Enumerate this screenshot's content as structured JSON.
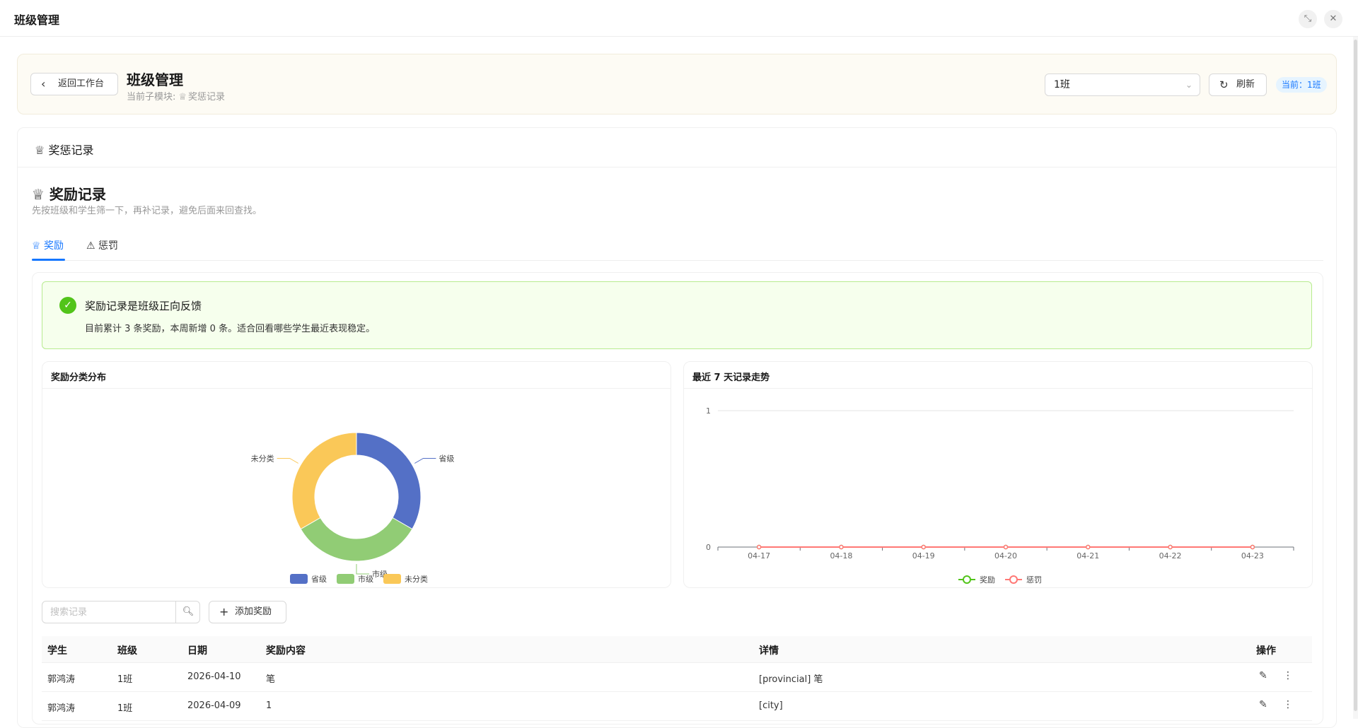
{
  "window": {
    "title": "班级管理",
    "collapse_icon": "collapse-icon",
    "close_icon": "close-icon"
  },
  "header": {
    "back_label": "返回工作台",
    "title": "班级管理",
    "sub_prefix": "当前子模块:",
    "sub_module": "奖惩记录",
    "class_select_value": "1班",
    "refresh_label": "刷新",
    "current_badge": "当前：1班"
  },
  "card": {
    "title": "奖惩记录"
  },
  "section": {
    "title": "奖励记录",
    "desc": "先按班级和学生筛一下，再补记录，避免后面来回查找。"
  },
  "tabs": [
    {
      "label": "奖励",
      "active": true
    },
    {
      "label": "惩罚",
      "active": false
    }
  ],
  "alert": {
    "title": "奖励记录是班级正向反馈",
    "desc": "目前累计 3 条奖励，本周新增 0 条。适合回看哪些学生最近表现稳定。"
  },
  "pie_chart": {
    "title": "奖励分类分布",
    "chart_data": {
      "type": "pie",
      "slices": [
        {
          "name": "省级",
          "value": 1,
          "color": "#5470c6"
        },
        {
          "name": "市级",
          "value": 1,
          "color": "#91cc75"
        },
        {
          "name": "未分类",
          "value": 1,
          "color": "#fac858"
        }
      ],
      "legend": [
        "省级",
        "市级",
        "未分类"
      ]
    }
  },
  "line_chart": {
    "title": "最近 7 天记录走势",
    "chart_data": {
      "type": "line",
      "x": [
        "04-17",
        "04-18",
        "04-19",
        "04-20",
        "04-21",
        "04-22",
        "04-23"
      ],
      "y_ticks": [
        "0",
        "1"
      ],
      "ylim": [
        0,
        1
      ],
      "series": [
        {
          "name": "奖励",
          "values": [
            0,
            0,
            0,
            0,
            0,
            0,
            0
          ],
          "color": "#52c41a"
        },
        {
          "name": "惩罚",
          "values": [
            0,
            0,
            0,
            0,
            0,
            0,
            0
          ],
          "color": "#ff7875"
        }
      ]
    }
  },
  "toolbar": {
    "search_placeholder": "搜索记录",
    "add_label": "添加奖励"
  },
  "table": {
    "headers": [
      "学生",
      "班级",
      "日期",
      "奖励内容",
      "详情",
      "操作"
    ],
    "rows": [
      {
        "student": "郭鸿涛",
        "class": "1班",
        "date": "2026-04-10",
        "content": "笔",
        "detail": "[provincial] 笔"
      },
      {
        "student": "郭鸿涛",
        "class": "1班",
        "date": "2026-04-09",
        "content": "1",
        "detail": "[city]"
      }
    ]
  }
}
